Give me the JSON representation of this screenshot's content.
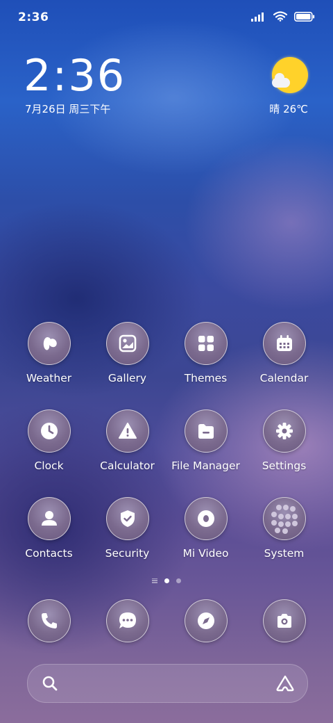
{
  "status_bar": {
    "time": "2:36",
    "icons": [
      "signal-icon",
      "wifi-icon",
      "battery-icon"
    ]
  },
  "lock_clock": {
    "time": "2:36",
    "date": "7月26日 周三下午"
  },
  "weather": {
    "icon": "sun-cloud-icon",
    "text": "晴 26℃"
  },
  "apps": [
    {
      "label": "Weather",
      "icon": "weather-icon"
    },
    {
      "label": "Gallery",
      "icon": "gallery-icon"
    },
    {
      "label": "Themes",
      "icon": "themes-icon"
    },
    {
      "label": "Calendar",
      "icon": "calendar-icon"
    },
    {
      "label": "Clock",
      "icon": "clock-icon"
    },
    {
      "label": "Calculator",
      "icon": "calculator-icon"
    },
    {
      "label": "File Manager",
      "icon": "file-manager-icon"
    },
    {
      "label": "Settings",
      "icon": "settings-icon"
    },
    {
      "label": "Contacts",
      "icon": "contacts-icon"
    },
    {
      "label": "Security",
      "icon": "security-icon"
    },
    {
      "label": "Mi Video",
      "icon": "mi-video-icon"
    },
    {
      "label": "System",
      "icon": "system-folder-icon"
    }
  ],
  "page_indicator": {
    "pages": 3,
    "active": 2
  },
  "dock": [
    {
      "icon": "phone-icon"
    },
    {
      "icon": "messages-icon"
    },
    {
      "icon": "browser-icon"
    },
    {
      "icon": "camera-icon"
    }
  ],
  "search_bar": {
    "left_icon": "search-icon",
    "right_icon": "assistant-icon"
  },
  "colors": {
    "sun": "#ffd22a",
    "icon_bg": "#7b6a8e"
  }
}
